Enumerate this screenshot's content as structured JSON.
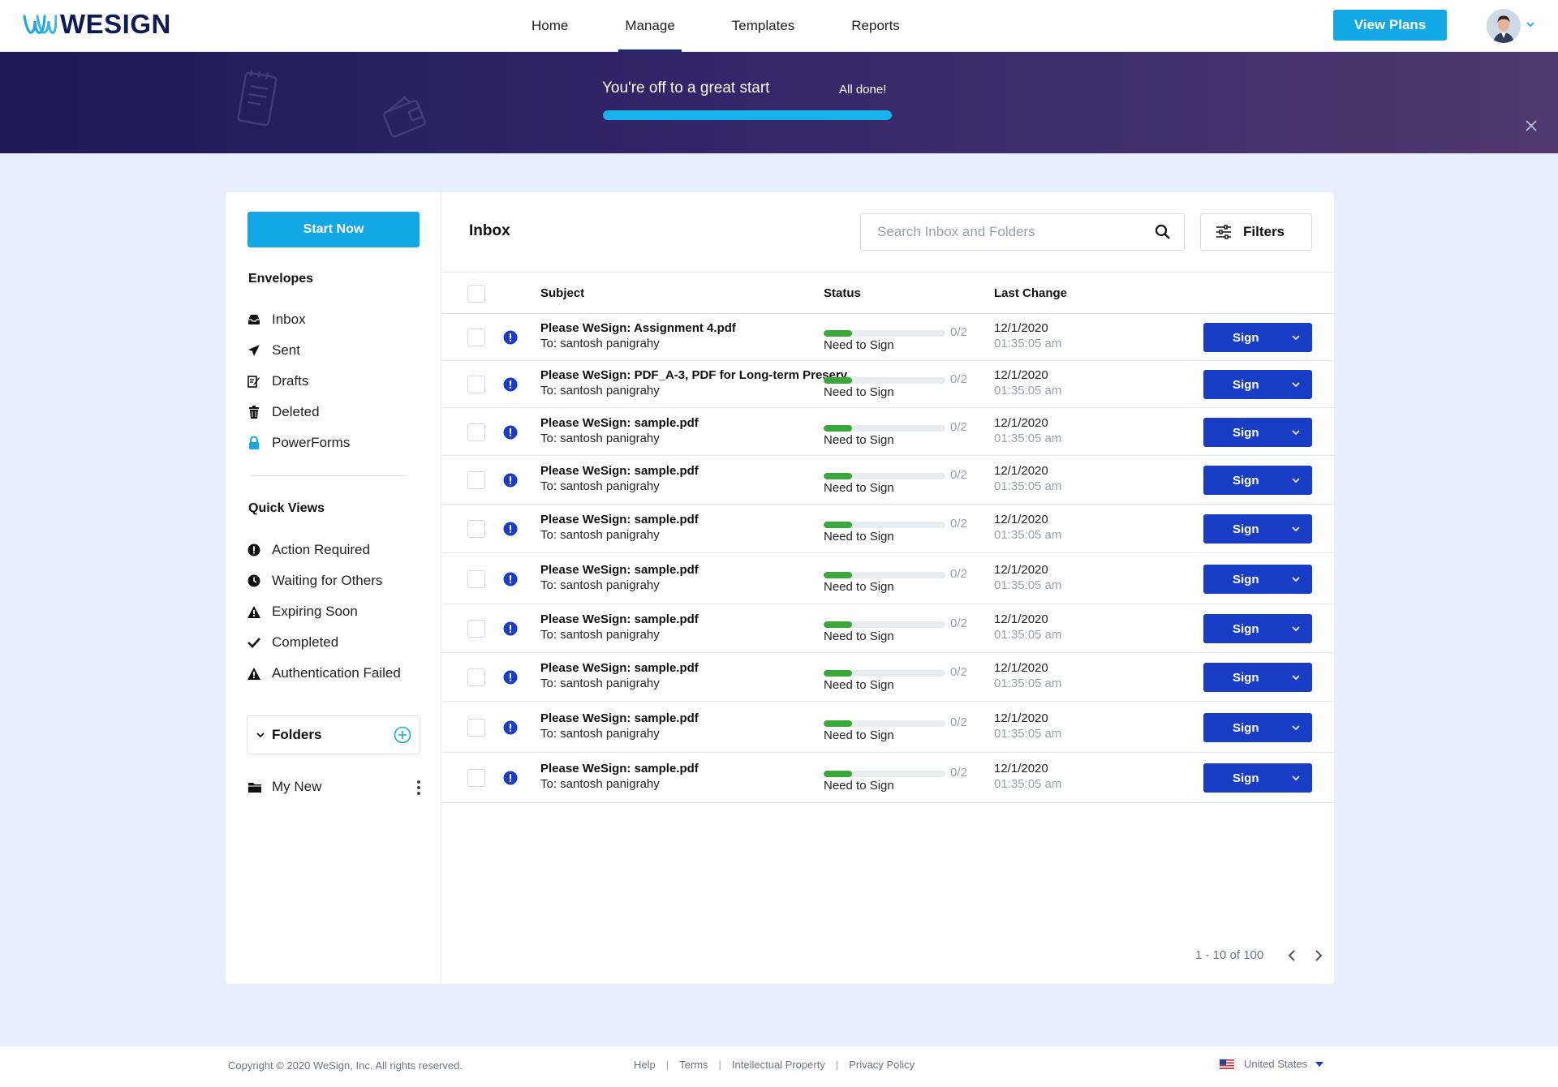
{
  "app": {
    "logo_text": "WESIGN"
  },
  "nav": {
    "items": [
      {
        "label": "Home"
      },
      {
        "label": "Manage",
        "active": true
      },
      {
        "label": "Templates"
      },
      {
        "label": "Reports"
      }
    ],
    "view_plans_label": "View Plans"
  },
  "banner": {
    "title": "You're off to a great start",
    "done_label": "All done!",
    "progress": 1.0
  },
  "sidebar": {
    "start_label": "Start Now",
    "envelopes_heading": "Envelopes",
    "envelopes": [
      {
        "label": "Inbox",
        "icon": "inbox-icon"
      },
      {
        "label": "Sent",
        "icon": "paper-plane-icon"
      },
      {
        "label": "Drafts",
        "icon": "draft-edit-icon"
      },
      {
        "label": "Deleted",
        "icon": "trash-icon"
      },
      {
        "label": "PowerForms",
        "icon": "lock-icon"
      }
    ],
    "quick_views_heading": "Quick Views",
    "quick_views": [
      {
        "label": "Action Required",
        "icon": "exclamation-circle-icon"
      },
      {
        "label": "Waiting for Others",
        "icon": "clock-icon"
      },
      {
        "label": "Expiring Soon",
        "icon": "warning-triangle-icon"
      },
      {
        "label": "Completed",
        "icon": "checkmark-icon"
      },
      {
        "label": "Authentication Failed",
        "icon": "warning-triangle-icon"
      }
    ],
    "folders_label": "Folders",
    "folder_items": [
      {
        "label": "My New"
      }
    ]
  },
  "main": {
    "title": "Inbox",
    "search_placeholder": "Search Inbox and Folders",
    "filters_label": "Filters",
    "columns": {
      "subject": "Subject",
      "status": "Status",
      "last_change": "Last Change"
    },
    "rows": [
      {
        "subject": "Please WeSign: Assignment 4.pdf",
        "to": "To: santosh panigrahy",
        "progress_count": "0/2",
        "progress": 0.23,
        "status": "Need to Sign",
        "date": "12/1/2020",
        "time": "01:35:05 am",
        "action": "Sign"
      },
      {
        "subject": "Please WeSign: PDF_A-3, PDF for Long-term Preserv...",
        "to": "To: santosh panigrahy",
        "progress_count": "0/2",
        "progress": 0.23,
        "status": "Need to Sign",
        "date": "12/1/2020",
        "time": "01:35:05 am",
        "action": "Sign"
      },
      {
        "subject": "Please WeSign: sample.pdf",
        "to": "To: santosh panigrahy",
        "progress_count": "0/2",
        "progress": 0.23,
        "status": "Need to Sign",
        "date": "12/1/2020",
        "time": "01:35:05 am",
        "action": "Sign"
      },
      {
        "subject": "Please WeSign: sample.pdf",
        "to": "To: santosh panigrahy",
        "progress_count": "0/2",
        "progress": 0.23,
        "status": "Need to Sign",
        "date": "12/1/2020",
        "time": "01:35:05 am",
        "action": "Sign"
      },
      {
        "subject": "Please WeSign: sample.pdf",
        "to": "To: santosh panigrahy",
        "progress_count": "0/2",
        "progress": 0.23,
        "status": "Need to Sign",
        "date": "12/1/2020",
        "time": "01:35:05 am",
        "action": "Sign"
      },
      {
        "subject": "Please WeSign: sample.pdf",
        "to": "To: santosh panigrahy",
        "progress_count": "0/2",
        "progress": 0.23,
        "status": "Need to Sign",
        "date": "12/1/2020",
        "time": "01:35:05 am",
        "action": "Sign"
      },
      {
        "subject": "Please WeSign: sample.pdf",
        "to": "To: santosh panigrahy",
        "progress_count": "0/2",
        "progress": 0.23,
        "status": "Need to Sign",
        "date": "12/1/2020",
        "time": "01:35:05 am",
        "action": "Sign"
      },
      {
        "subject": "Please WeSign: sample.pdf",
        "to": "To: santosh panigrahy",
        "progress_count": "0/2",
        "progress": 0.23,
        "status": "Need to Sign",
        "date": "12/1/2020",
        "time": "01:35:05 am",
        "action": "Sign"
      },
      {
        "subject": "Please WeSign: sample.pdf",
        "to": "To: santosh panigrahy",
        "progress_count": "0/2",
        "progress": 0.23,
        "status": "Need to Sign",
        "date": "12/1/2020",
        "time": "01:35:05 am",
        "action": "Sign"
      },
      {
        "subject": "Please WeSign: sample.pdf",
        "to": "To: santosh panigrahy",
        "progress_count": "0/2",
        "progress": 0.23,
        "status": "Need to Sign",
        "date": "12/1/2020",
        "time": "01:35:05 am",
        "action": "Sign"
      }
    ],
    "pagination": "1 - 10 of 100"
  },
  "footer": {
    "copyright": "Copyright © 2020 WeSign, Inc. All rights reserved.",
    "links": [
      "Help",
      "Terms",
      "Intellectual Property",
      "Privacy Policy"
    ],
    "locale": "United States"
  },
  "colors": {
    "accent": "#13a7e6",
    "sign_button": "#1a3dc7",
    "progress_fill": "#3aa83a",
    "banner_start": "#1c1a55",
    "banner_end": "#503870"
  }
}
